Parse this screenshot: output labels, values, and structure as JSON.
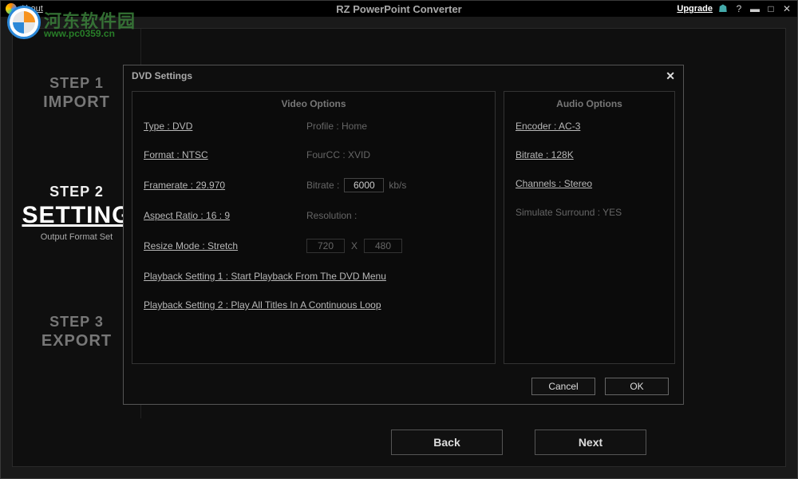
{
  "titlebar": {
    "about": "About",
    "title": "RZ PowerPoint Converter",
    "upgrade": "Upgrade"
  },
  "watermark": {
    "text1": "河东软件园",
    "text2": "www.pc0359.cn"
  },
  "sidebar": {
    "steps": [
      {
        "num": "STEP 1",
        "name": "IMPORT",
        "caption": ""
      },
      {
        "num": "STEP 2",
        "name": "SETTING",
        "caption": "Output Format Set"
      },
      {
        "num": "STEP 3",
        "name": "EXPORT",
        "caption": ""
      }
    ]
  },
  "buttons": {
    "back": "Back",
    "next": "Next"
  },
  "dialog": {
    "title": "DVD Settings",
    "video_header": "Video Options",
    "audio_header": "Audio Options",
    "type": "Type : DVD",
    "profile": "Profile : Home",
    "format": "Format : NTSC",
    "fourcc": "FourCC : XVID",
    "framerate": "Framerate : 29.970",
    "bitrate_label": "Bitrate :",
    "bitrate_value": "6000",
    "bitrate_unit": "kb/s",
    "aspect": "Aspect Ratio : 16 : 9",
    "resolution_label": "Resolution :",
    "resize": "Resize Mode : Stretch",
    "res_w": "720",
    "res_x": "X",
    "res_h": "480",
    "pb1": "Playback Setting 1 : Start Playback From The DVD Menu",
    "pb2": "Playback Setting 2 : Play All Titles In A Continuous Loop",
    "encoder": "Encoder : AC-3",
    "a_bitrate": "Bitrate : 128K",
    "channels": "Channels : Stereo",
    "surround": "Simulate Surround : YES",
    "cancel": "Cancel",
    "ok": "OK"
  }
}
